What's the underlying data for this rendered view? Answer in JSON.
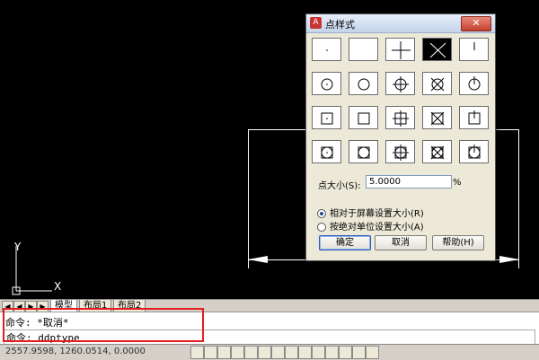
{
  "dialog": {
    "title": "点样式",
    "close_icon": "✕",
    "size_label": "点大小(S):",
    "size_value": "5.0000",
    "size_unit": "%",
    "radio_relative": "相对于屏幕设置大小(R)",
    "radio_absolute": "按绝对单位设置大小(A)",
    "ok": "确定",
    "cancel": "取消",
    "help": "帮助(H)"
  },
  "tabs": {
    "model": "模型",
    "layout1": "布局1",
    "layout2": "布局2"
  },
  "command": {
    "line1": "命令: *取消*",
    "line2": "命令: ddptype"
  },
  "status": {
    "coords": "2557.9598, 1260.0514, 0.0000"
  },
  "ucs": {
    "x": "X",
    "y": "Y"
  },
  "colors": {
    "highlight": "#e41e1e",
    "titlebar": "#c5d4ea"
  }
}
